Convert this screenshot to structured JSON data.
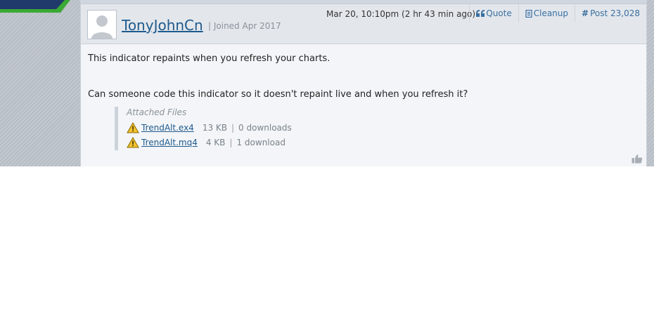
{
  "post": {
    "username": "TonyJohnCn",
    "joined": "| Joined Apr 2017",
    "timestamp": "Mar 20, 10:10pm (2 hr 43 min ago)",
    "actions": {
      "quote": "Quote",
      "cleanup": "Cleanup",
      "post_number": "Post 23,028"
    },
    "body": [
      "This indicator repaints when you refresh your charts.",
      "Can someone code this indicator so it doesn't repaint live and when you refresh it?"
    ],
    "attachments": {
      "heading": "Attached Files",
      "files": [
        {
          "name": "TrendAlt.ex4",
          "size": "13 KB",
          "downloads": "0 downloads"
        },
        {
          "name": "TrendAlt.mq4",
          "size": "4 KB",
          "downloads": "1 download"
        }
      ]
    }
  },
  "icons": {
    "quote": "quote-icon",
    "cleanup": "cleanup-icon",
    "post": "hash-icon",
    "file": "warning-icon",
    "like": "thumbs-up-icon"
  },
  "colors": {
    "link": "#1f5a8c",
    "header_bg": "#e3e7ec",
    "post_bg": "#f3f5f8",
    "logo_green": "#3aa935",
    "logo_navy": "#1f3a6b"
  }
}
